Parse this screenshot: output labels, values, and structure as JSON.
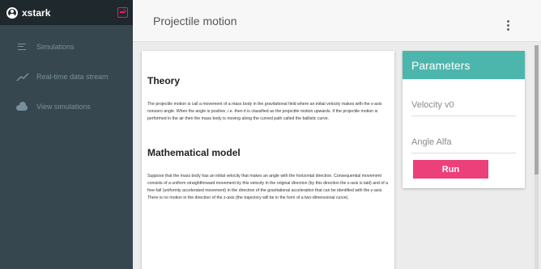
{
  "user": {
    "name": "xstark"
  },
  "sidebar": {
    "items": [
      {
        "label": "Simulations",
        "icon": "list-icon"
      },
      {
        "label": "Real-time data stream",
        "icon": "trend-icon"
      },
      {
        "label": "View simulations",
        "icon": "cloud-icon"
      }
    ]
  },
  "topbar": {
    "title": "Projectile motion"
  },
  "theory": {
    "title": "Theory",
    "body": "The projectile motion is call a movement of a mass body in the gravitational field where an initial velocity makes with the x-axis nonzero angle. When the angle is positive, i.e. then it is classified as the projectile motion upwards. If the projectile motion is performed in the air then the mass body is moving along the curved path called the ballistic curve.",
    "model_title": "Mathematical model",
    "model_body": "Suppose that the mass body has an initial velocity that makes an angle with the horizontal direction. Consequential movement consists of a uniform straightforward movement by this velocity in the original direction (by this direction the x-axis is laid) and of a free-fall (uniformly accelerated movement) in the direction of the gravitational acceleration that can be identified with the y-axis. There is no motion in the direction of the z-axis (the trajectory will be in the form of a two-dimensional curve)."
  },
  "parameters": {
    "title": "Parameters",
    "velocity_placeholder": "Velocity v0",
    "angle_placeholder": "Angle Alfa",
    "run_label": "Run"
  },
  "colors": {
    "accent": "#4db6ac",
    "button": "#ec407a",
    "sidebar": "#263238"
  }
}
